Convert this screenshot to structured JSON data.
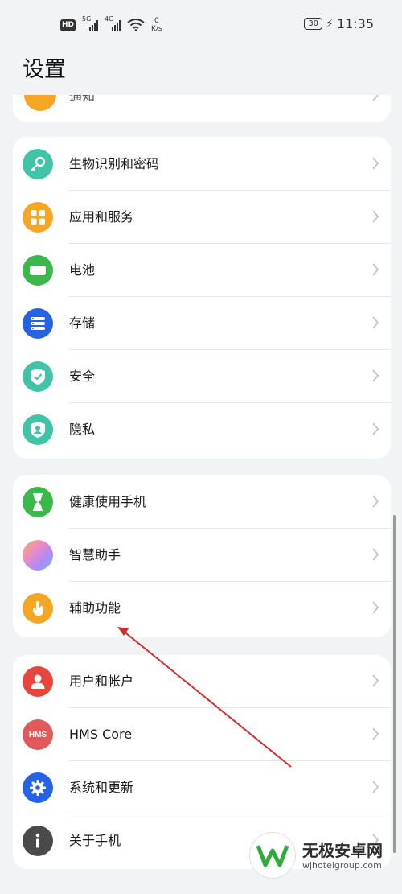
{
  "statusbar": {
    "hd": "HD",
    "sim1_gen": "5G",
    "sim2_gen": "4G",
    "speed_value": "0",
    "speed_unit": "K/s",
    "battery": "30",
    "time": "11:35"
  },
  "page_title": "设置",
  "top_fragment": {
    "label": "通知"
  },
  "groups": [
    {
      "items": [
        {
          "label": "生物识别和密码",
          "icon": "key-icon",
          "color": "#41c3a8"
        },
        {
          "label": "应用和服务",
          "icon": "apps-grid-icon",
          "color": "#f4a624"
        },
        {
          "label": "电池",
          "icon": "battery-icon",
          "color": "#3bb84a"
        },
        {
          "label": "存储",
          "icon": "storage-icon",
          "color": "#2463e6"
        },
        {
          "label": "安全",
          "icon": "shield-check-icon",
          "color": "#41c3a8"
        },
        {
          "label": "隐私",
          "icon": "privacy-shield-icon",
          "color": "#41c3a8"
        }
      ]
    },
    {
      "items": [
        {
          "label": "健康使用手机",
          "icon": "hourglass-icon",
          "color": "#3bb84a"
        },
        {
          "label": "智慧助手",
          "icon": "smart-assistant-icon",
          "color": "#c98bd8"
        },
        {
          "label": "辅助功能",
          "icon": "hand-icon",
          "color": "#f4a624"
        }
      ]
    },
    {
      "items": [
        {
          "label": "用户和帐户",
          "icon": "user-icon",
          "color": "#e8453c"
        },
        {
          "label": "HMS Core",
          "icon": "hms-icon",
          "color": "#e05a5a",
          "icon_text": "HMS"
        },
        {
          "label": "系统和更新",
          "icon": "gear-icon",
          "color": "#2463e6"
        },
        {
          "label": "关于手机",
          "icon": "info-icon",
          "color": "#4a4a4a"
        }
      ]
    }
  ],
  "watermark": {
    "title": "无极安卓网",
    "url": "wjhotelgroup.com"
  }
}
